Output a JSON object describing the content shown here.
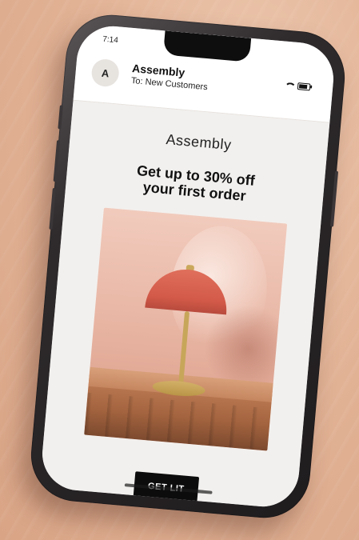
{
  "status_bar": {
    "time": "7:14",
    "icons": [
      "wifi-icon",
      "battery-icon"
    ]
  },
  "email": {
    "sender_initial": "A",
    "sender_name": "Assembly",
    "to_line": "To: New Customers",
    "brand": "Assembly",
    "headline_line1": "Get up to 30% off",
    "headline_line2": "your first order",
    "cta_label": "GET LIT"
  },
  "colors": {
    "phone_frame": "#1f1c1e",
    "screen_bg": "#f2f0ee",
    "cta_bg": "#0c0c0c",
    "lamp_shade": "#d35a49",
    "desk_background": "#e3b497"
  }
}
